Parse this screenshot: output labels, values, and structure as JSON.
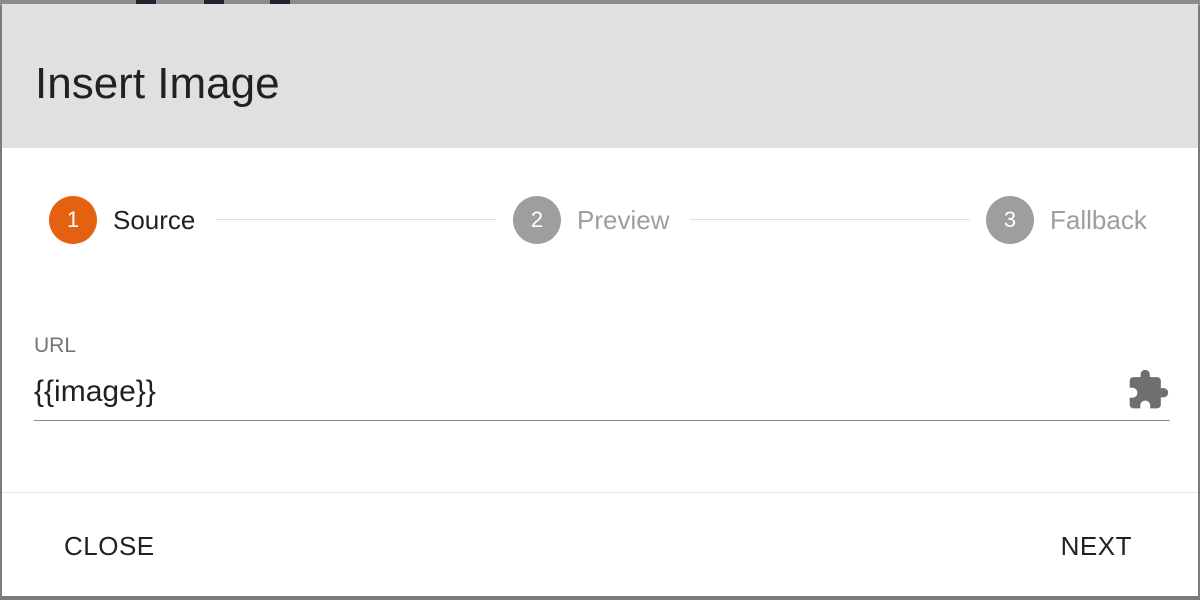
{
  "dialog": {
    "title": "Insert Image"
  },
  "stepper": {
    "steps": [
      {
        "number": "1",
        "label": "Source",
        "state": "active"
      },
      {
        "number": "2",
        "label": "Preview",
        "state": "inactive"
      },
      {
        "number": "3",
        "label": "Fallback",
        "state": "inactive"
      }
    ]
  },
  "url_field": {
    "label": "URL",
    "value": "{{image}}",
    "icon": "puzzle-piece-icon"
  },
  "actions": {
    "close_label": "CLOSE",
    "next_label": "NEXT"
  },
  "colors": {
    "accent": "#e4610f",
    "inactive_step": "#9e9e9e",
    "header_bg": "#e0e0e0",
    "text": "#212121"
  }
}
